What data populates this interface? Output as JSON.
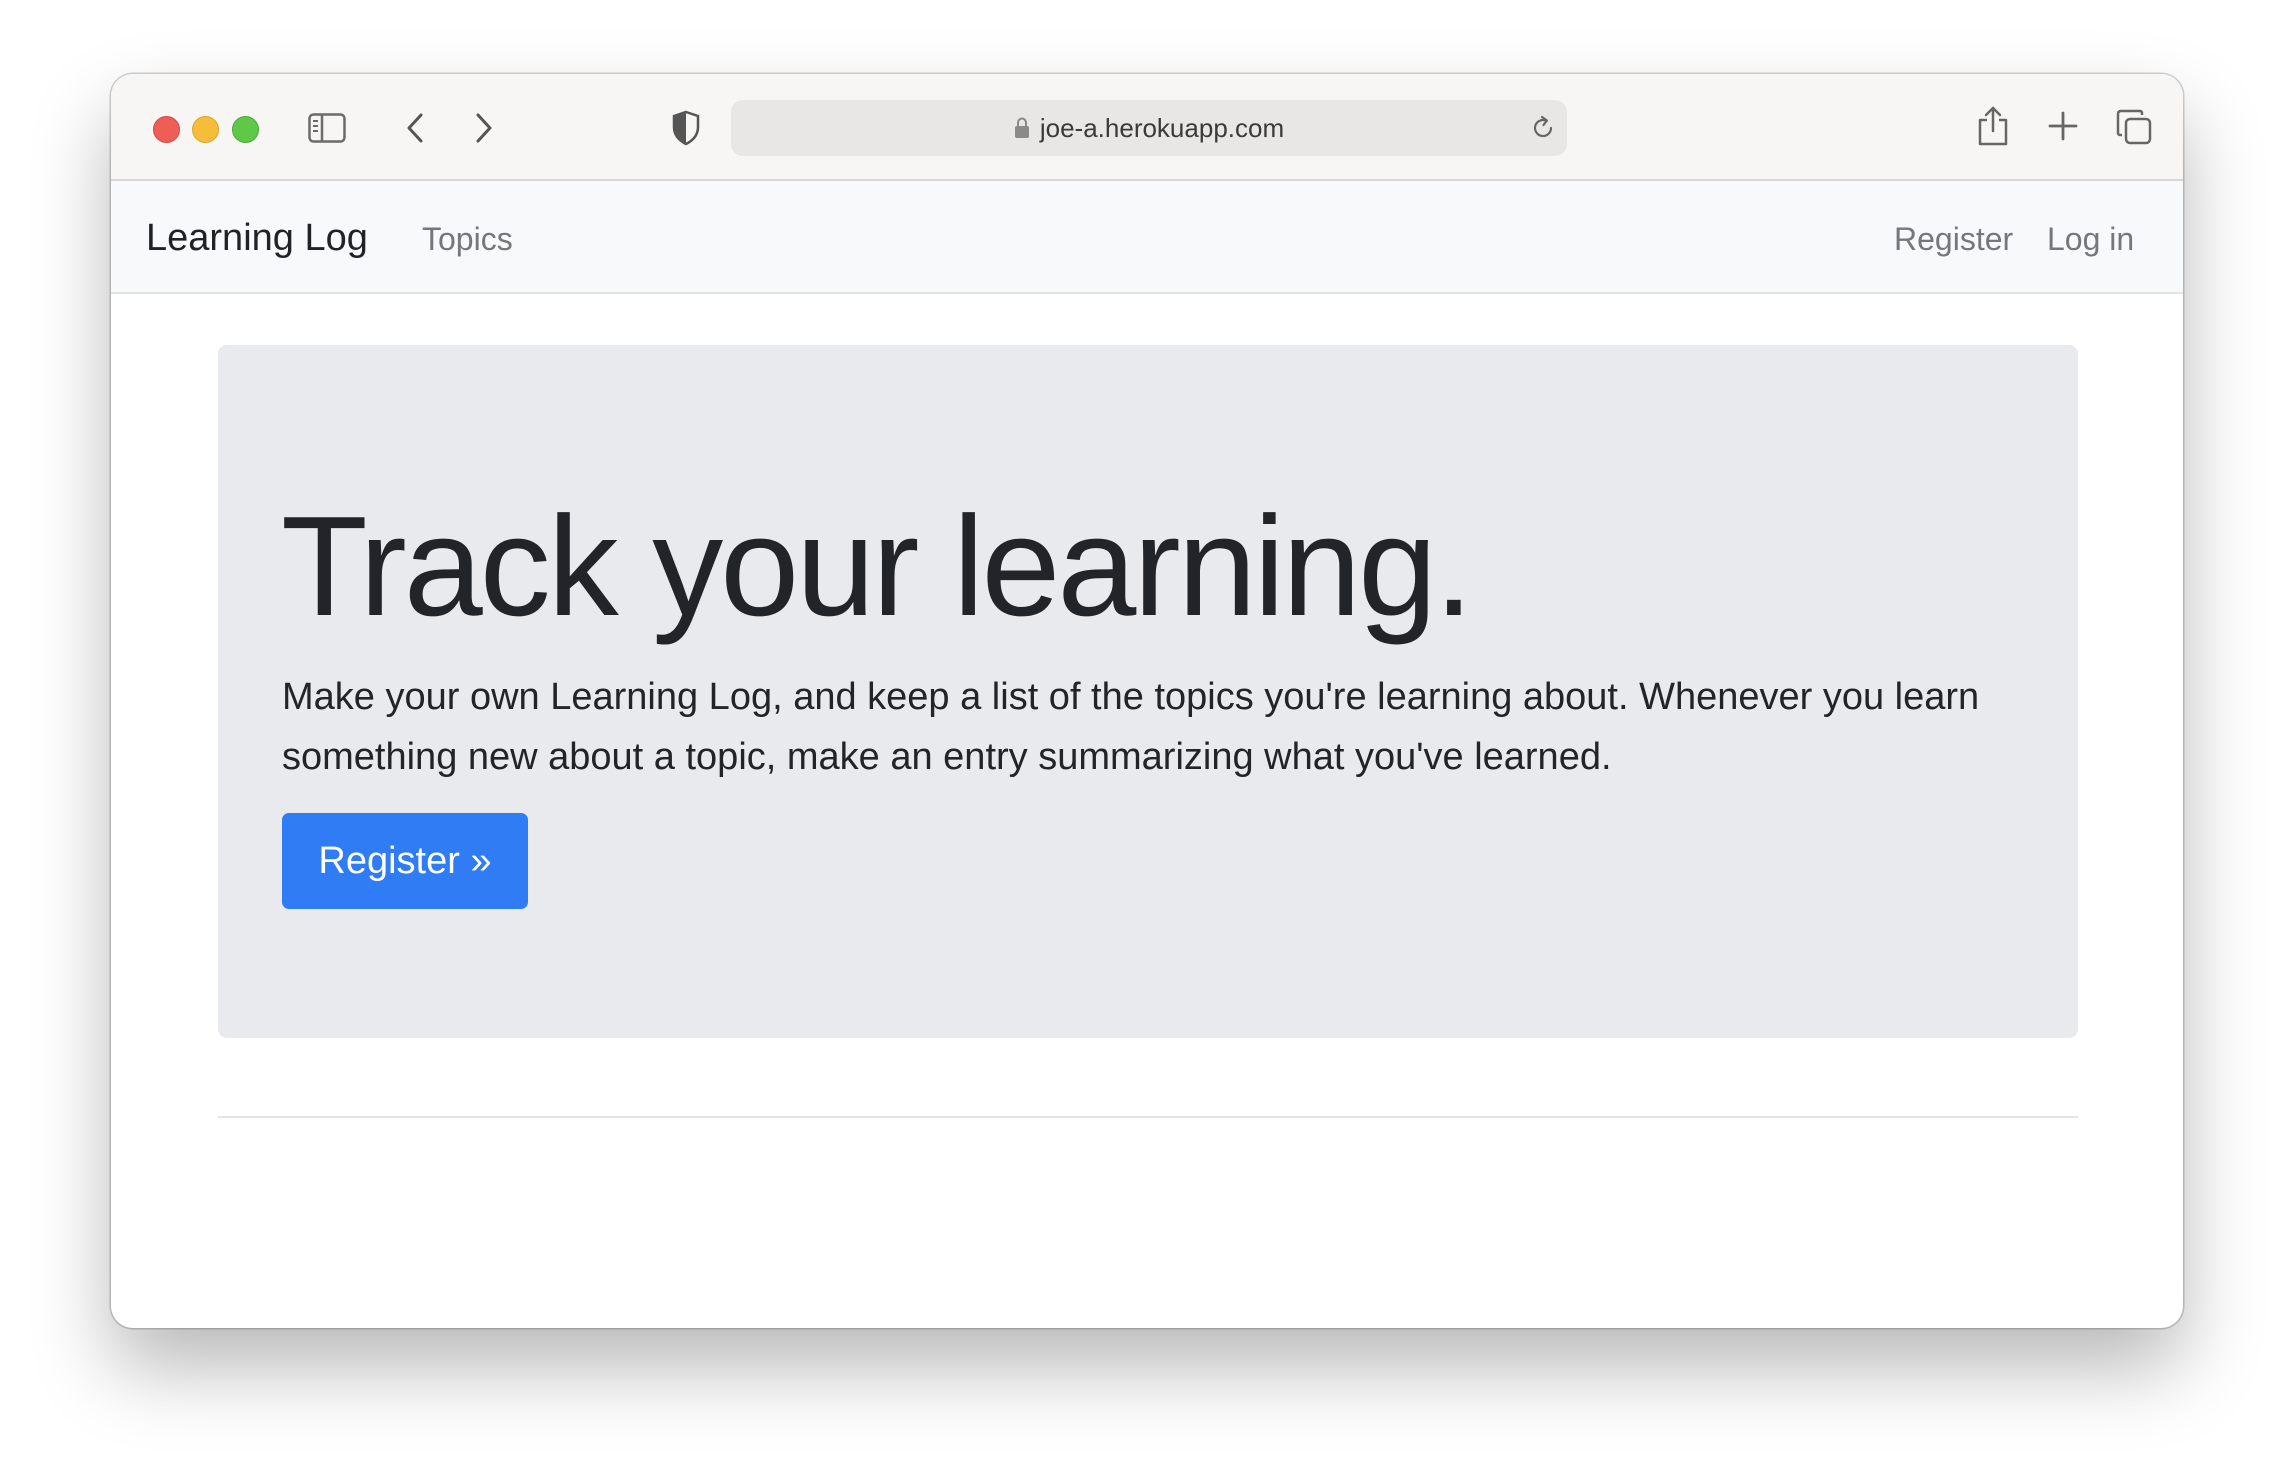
{
  "browser": {
    "url": "joe-a.herokuapp.com",
    "icons": {
      "sidebar": "sidebar-icon",
      "back": "chevron-left-icon",
      "forward": "chevron-right-icon",
      "privacy": "shield-icon",
      "lock": "lock-icon",
      "reload": "reload-icon",
      "share": "share-icon",
      "new_tab": "plus-icon",
      "tabs": "tab-overview-icon"
    }
  },
  "navbar": {
    "brand": "Learning Log",
    "links": {
      "topics": "Topics",
      "register": "Register",
      "login": "Log in"
    }
  },
  "hero": {
    "headline": "Track your learning.",
    "lead": "Make your own Learning Log, and keep a list of the topics you're learning about. Whenever you learn something new about a topic, make an entry summarizing what you've learned.",
    "button_label": "Register »"
  },
  "colors": {
    "accent": "#2f7cf5",
    "jumbotron_bg": "#e9eaee",
    "navbar_bg": "#f8f9fa"
  }
}
